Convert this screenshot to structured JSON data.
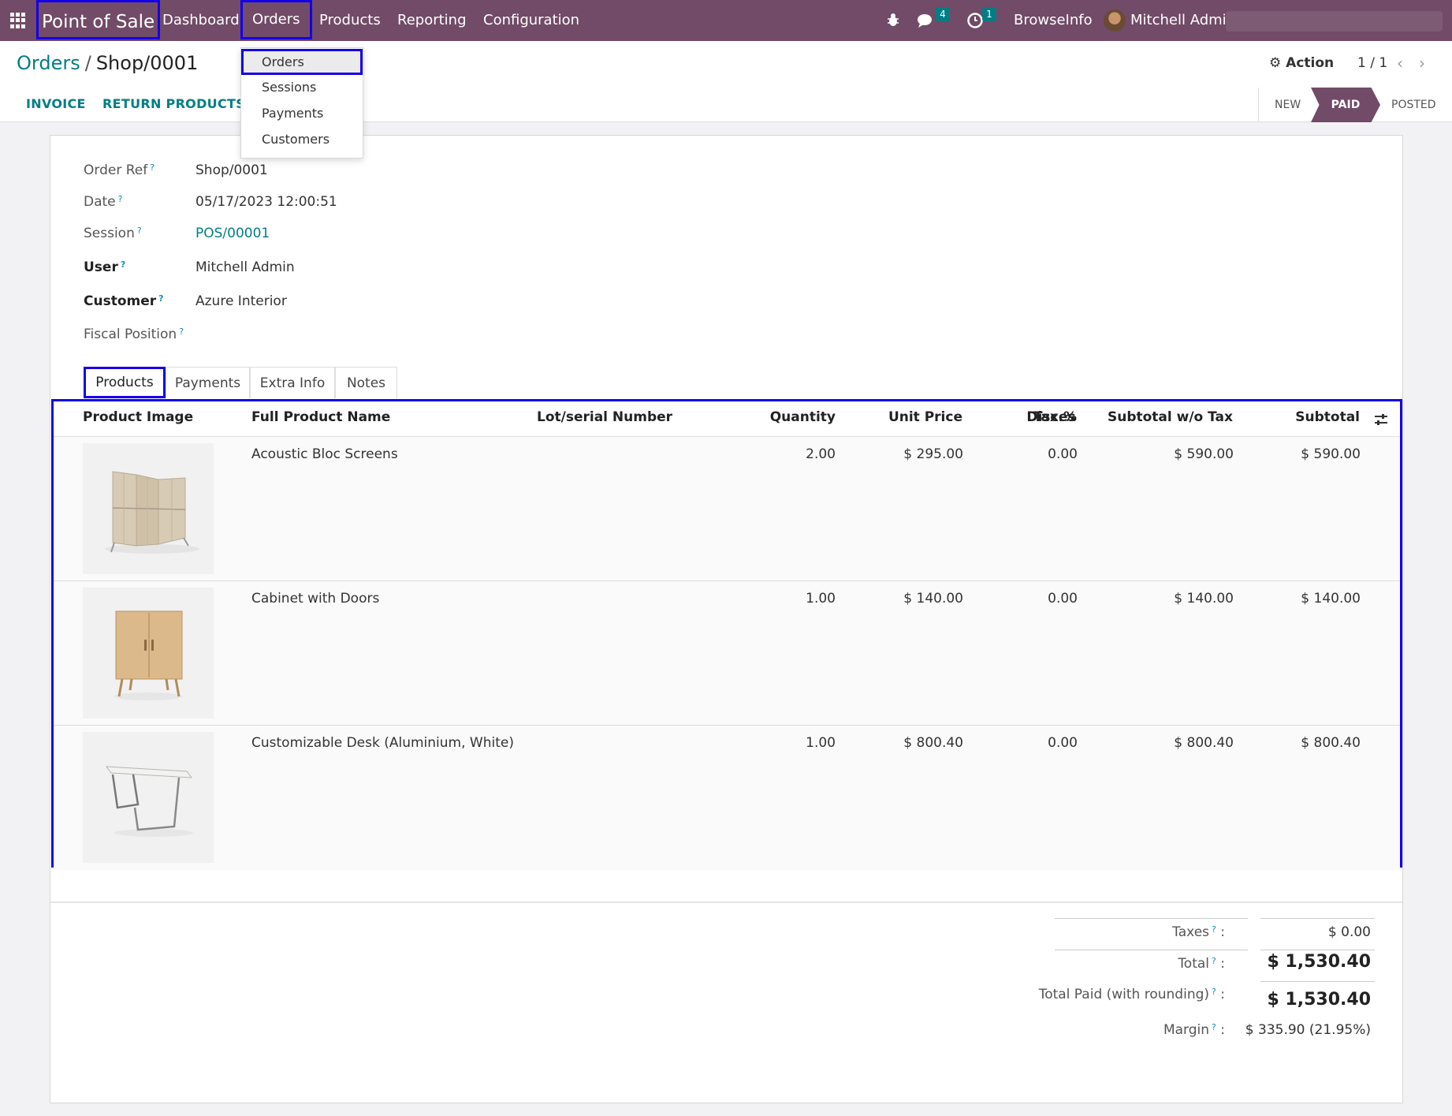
{
  "navbar": {
    "app_name": "Point of Sale",
    "menus": [
      "Dashboard",
      "Orders",
      "Products",
      "Reporting",
      "Configuration"
    ],
    "messages_count": "4",
    "activities_count": "1",
    "company": "BrowseInfo",
    "user": "Mitchell Admin"
  },
  "orders_dropdown": [
    "Orders",
    "Sessions",
    "Payments",
    "Customers"
  ],
  "breadcrumb": {
    "parent": "Orders",
    "separator": "/",
    "current": "Shop/0001"
  },
  "control": {
    "action_label": "Action",
    "pager": "1 / 1",
    "buttons": [
      "INVOICE",
      "RETURN PRODUCTS"
    ],
    "stages": [
      "NEW",
      "PAID",
      "POSTED"
    ],
    "active_stage": "PAID"
  },
  "fields": {
    "order_ref": {
      "label": "Order Ref",
      "value": "Shop/0001"
    },
    "date": {
      "label": "Date",
      "value": "05/17/2023 12:00:51"
    },
    "session": {
      "label": "Session",
      "value": "POS/00001"
    },
    "user": {
      "label": "User",
      "value": "Mitchell Admin"
    },
    "customer": {
      "label": "Customer",
      "value": "Azure Interior"
    },
    "fiscal_position": {
      "label": "Fiscal Position",
      "value": ""
    }
  },
  "tabs": [
    "Products",
    "Payments",
    "Extra Info",
    "Notes"
  ],
  "table": {
    "columns": [
      "Product Image",
      "Full Product Name",
      "Lot/serial Number",
      "Quantity",
      "Unit Price",
      "Disc.%",
      "Taxes",
      "Subtotal w/o Tax",
      "Subtotal"
    ],
    "rows": [
      {
        "name": "Acoustic Bloc Screens",
        "lot": "",
        "qty": "2.00",
        "unit_price": "$ 295.00",
        "disc": "0.00",
        "taxes": "",
        "subtotal_wo_tax": "$ 590.00",
        "subtotal": "$ 590.00",
        "image": "acoustic-screen"
      },
      {
        "name": "Cabinet with Doors",
        "lot": "",
        "qty": "1.00",
        "unit_price": "$ 140.00",
        "disc": "0.00",
        "taxes": "",
        "subtotal_wo_tax": "$ 140.00",
        "subtotal": "$ 140.00",
        "image": "cabinet"
      },
      {
        "name": "Customizable Desk (Aluminium, White)",
        "lot": "",
        "qty": "1.00",
        "unit_price": "$ 800.40",
        "disc": "0.00",
        "taxes": "",
        "subtotal_wo_tax": "$ 800.40",
        "subtotal": "$ 800.40",
        "image": "desk"
      }
    ]
  },
  "totals": {
    "taxes": {
      "label": "Taxes",
      "value": "$ 0.00"
    },
    "total": {
      "label": "Total",
      "value": "$ 1,530.40"
    },
    "total_paid": {
      "label": "Total Paid (with rounding)",
      "value": "$ 1,530.40"
    },
    "margin": {
      "label": "Margin",
      "value": "$ 335.90 (21.95%)"
    }
  },
  "colors": {
    "brand": "#714b67",
    "link": "#017e84",
    "highlight_box": "#1400e8"
  }
}
